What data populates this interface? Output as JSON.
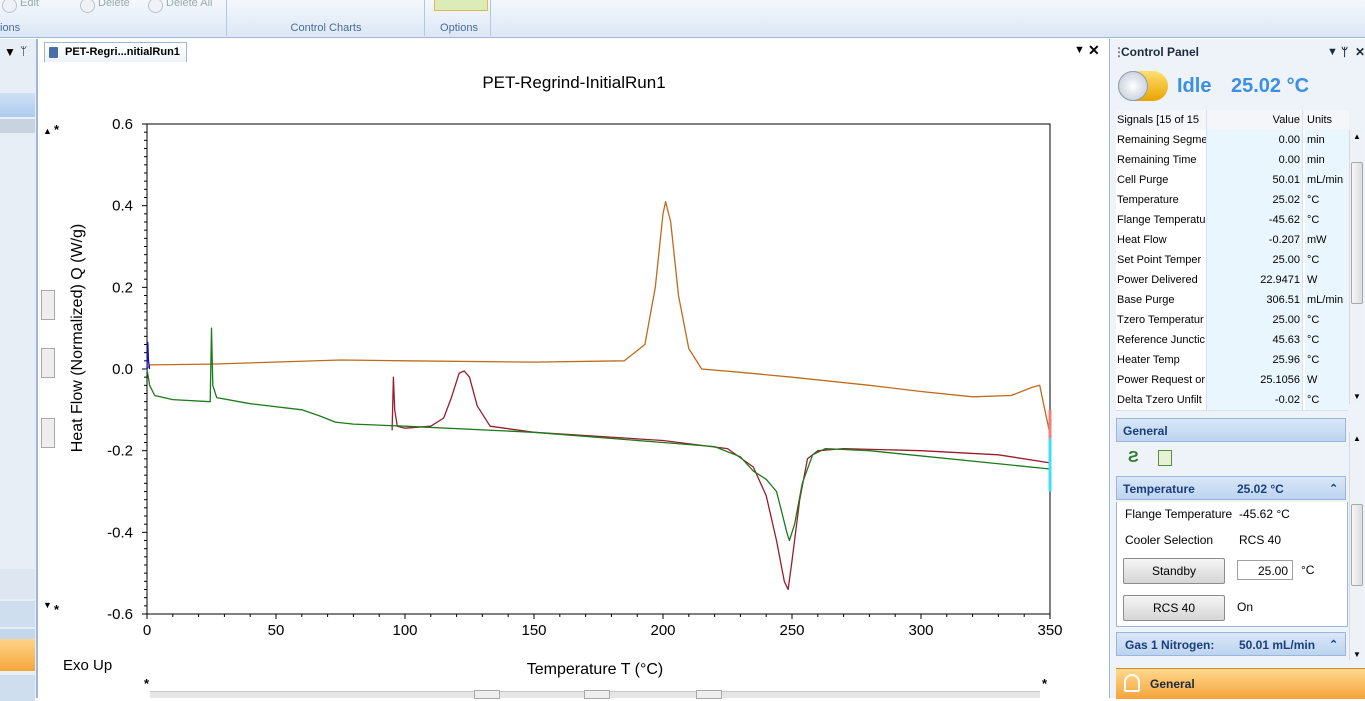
{
  "ribbon": {
    "edit_label": "Edit",
    "delete_label": "Delete",
    "delete_all_label": "Delete All",
    "group_left_caption": "ions",
    "control_charts_caption": "Control Charts",
    "options_caption": "Options"
  },
  "document": {
    "tab_title": "PET-Regri...nitialRun1",
    "exo_label": "Exo Up"
  },
  "chart_data": {
    "type": "line",
    "title": "PET-Regrind-InitialRun1",
    "xlabel": "Temperature  T  (°C)",
    "ylabel": "Heat Flow (Normalized)  Q  (W/g)",
    "xlim": [
      0,
      350
    ],
    "ylim": [
      -0.6,
      0.6
    ],
    "x_ticks": [
      "0",
      "50",
      "100",
      "150",
      "200",
      "250",
      "300",
      "350"
    ],
    "y_ticks": [
      "0.6",
      "0.4",
      "0.2",
      "0.0",
      "-0.2",
      "-0.4",
      "-0.6"
    ],
    "series": [
      {
        "color": "#c06a1a",
        "x": [
          0,
          1,
          25,
          75,
          100,
          150,
          185,
          193,
          197,
          200,
          201,
          203,
          206,
          210,
          215,
          230,
          250,
          280,
          300,
          320,
          335,
          343,
          346,
          348,
          350
        ],
        "y": [
          0.0,
          0.01,
          0.012,
          0.022,
          0.02,
          0.017,
          0.02,
          0.06,
          0.2,
          0.38,
          0.41,
          0.36,
          0.18,
          0.05,
          0.0,
          -0.008,
          -0.02,
          -0.04,
          -0.055,
          -0.068,
          -0.065,
          -0.045,
          -0.04,
          -0.1,
          -0.16
        ]
      },
      {
        "color": "#9b1b2e",
        "x": [
          95,
          95.5,
          96,
          97,
          100,
          110,
          115,
          118,
          121,
          123,
          125,
          128,
          133,
          150,
          200,
          225,
          235,
          240,
          244,
          247,
          248.5,
          250,
          253,
          256,
          260,
          270,
          300,
          330,
          350
        ],
        "y": [
          -0.15,
          -0.02,
          -0.1,
          -0.14,
          -0.145,
          -0.14,
          -0.12,
          -0.07,
          -0.01,
          -0.005,
          -0.02,
          -0.09,
          -0.14,
          -0.155,
          -0.175,
          -0.195,
          -0.24,
          -0.31,
          -0.42,
          -0.52,
          -0.54,
          -0.47,
          -0.32,
          -0.22,
          -0.2,
          -0.195,
          -0.2,
          -0.21,
          -0.23
        ]
      },
      {
        "color": "#1b7a1b",
        "x": [
          0,
          0.5,
          1,
          3,
          10,
          24.5,
          25,
          25.5,
          27,
          40,
          60,
          67,
          73,
          80,
          100,
          150,
          200,
          220,
          230,
          235,
          240,
          244,
          246,
          248,
          249,
          251,
          254,
          258,
          263,
          280,
          350
        ],
        "y": [
          0.0,
          -0.02,
          -0.04,
          -0.065,
          -0.075,
          -0.08,
          0.1,
          -0.04,
          -0.07,
          -0.085,
          -0.1,
          -0.115,
          -0.13,
          -0.135,
          -0.14,
          -0.155,
          -0.18,
          -0.19,
          -0.215,
          -0.25,
          -0.27,
          -0.3,
          -0.35,
          -0.4,
          -0.42,
          -0.38,
          -0.28,
          -0.21,
          -0.195,
          -0.2,
          -0.245
        ]
      },
      {
        "color": "#1010c0",
        "x": [
          0,
          0.3,
          0.6,
          1
        ],
        "y": [
          0.0,
          0.065,
          0.02,
          0.0
        ]
      }
    ]
  },
  "control_panel": {
    "title": "Control Panel",
    "status": "Idle",
    "temperature": "25.02 °C",
    "signals_header": {
      "name": "Signals [15 of 15",
      "value": "Value",
      "units": "Units"
    },
    "signals": [
      {
        "name": "Remaining Segme",
        "value": "0.00",
        "units": "min"
      },
      {
        "name": "Remaining Time",
        "value": "0.00",
        "units": "min"
      },
      {
        "name": "Cell Purge",
        "value": "50.01",
        "units": "mL/min"
      },
      {
        "name": "Temperature",
        "value": "25.02",
        "units": "°C"
      },
      {
        "name": "Flange Temperatu",
        "value": "-45.62",
        "units": "°C"
      },
      {
        "name": "Heat Flow",
        "value": "-0.207",
        "units": "mW"
      },
      {
        "name": "Set Point Temper",
        "value": "25.00",
        "units": "°C"
      },
      {
        "name": "Power Delivered",
        "value": "22.9471",
        "units": "W"
      },
      {
        "name": "Base Purge",
        "value": "306.51",
        "units": "mL/min"
      },
      {
        "name": "Tzero Temperatur",
        "value": "25.00",
        "units": "°C"
      },
      {
        "name": "Reference Junctic",
        "value": "45.63",
        "units": "°C"
      },
      {
        "name": "Heater Temp",
        "value": "25.96",
        "units": "°C"
      },
      {
        "name": "Power Request or",
        "value": "25.1056",
        "units": "W"
      },
      {
        "name": "Delta Tzero Unfilt",
        "value": "-0.02",
        "units": "°C"
      }
    ],
    "general_header": "General",
    "temperature_section": {
      "label": "Temperature",
      "value": "25.02 °C",
      "flange_label": "Flange Temperature",
      "flange_value": "-45.62 °C",
      "cooler_label": "Cooler Selection",
      "cooler_value": "RCS 40",
      "standby_button": "Standby",
      "setpoint_value": "25.00",
      "setpoint_unit": "°C",
      "rcs_button": "RCS 40",
      "rcs_state": "On"
    },
    "gas_section": {
      "label": "Gas 1 Nitrogen:",
      "value": "50.01 mL/min"
    },
    "footer_tab": "General"
  }
}
